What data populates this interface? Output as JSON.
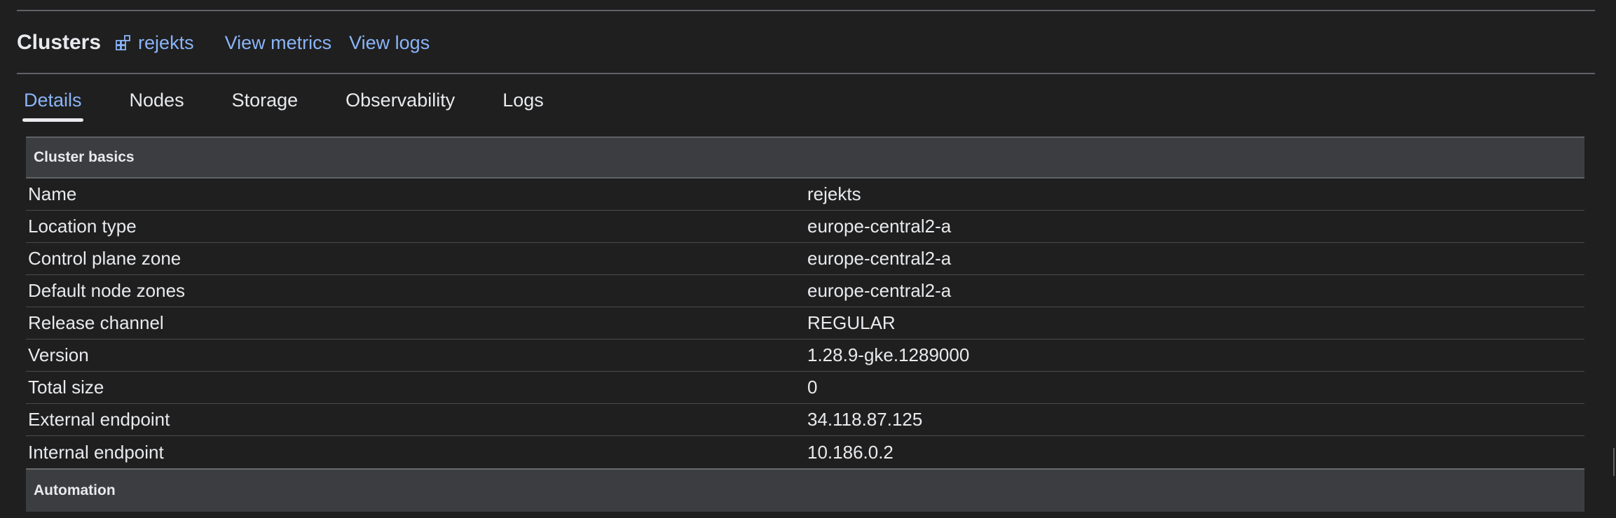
{
  "header": {
    "title": "Clusters",
    "cluster_name": "rejekts",
    "view_metrics": "View metrics",
    "view_logs": "View logs"
  },
  "tabs": [
    {
      "label": "Details",
      "active": true
    },
    {
      "label": "Nodes",
      "active": false
    },
    {
      "label": "Storage",
      "active": false
    },
    {
      "label": "Observability",
      "active": false
    },
    {
      "label": "Logs",
      "active": false
    }
  ],
  "sections": {
    "cluster_basics": {
      "title": "Cluster basics",
      "rows": [
        {
          "key": "Name",
          "value": "rejekts"
        },
        {
          "key": "Location type",
          "value": "europe-central2-a"
        },
        {
          "key": "Control plane zone",
          "value": "europe-central2-a"
        },
        {
          "key": "Default node zones",
          "value": "europe-central2-a"
        },
        {
          "key": "Release channel",
          "value": "REGULAR"
        },
        {
          "key": "Version",
          "value": "1.28.9-gke.1289000"
        },
        {
          "key": "Total size",
          "value": "0"
        },
        {
          "key": "External endpoint",
          "value": "34.118.87.125"
        },
        {
          "key": "Internal endpoint",
          "value": "10.186.0.2"
        }
      ]
    },
    "automation": {
      "title": "Automation"
    }
  },
  "colors": {
    "background": "#1f1f1f",
    "link": "#8ab4f8",
    "section_header_bg": "#3c3d40",
    "text": "#e8eaed"
  },
  "icons": {
    "cluster": "cluster-icon"
  }
}
